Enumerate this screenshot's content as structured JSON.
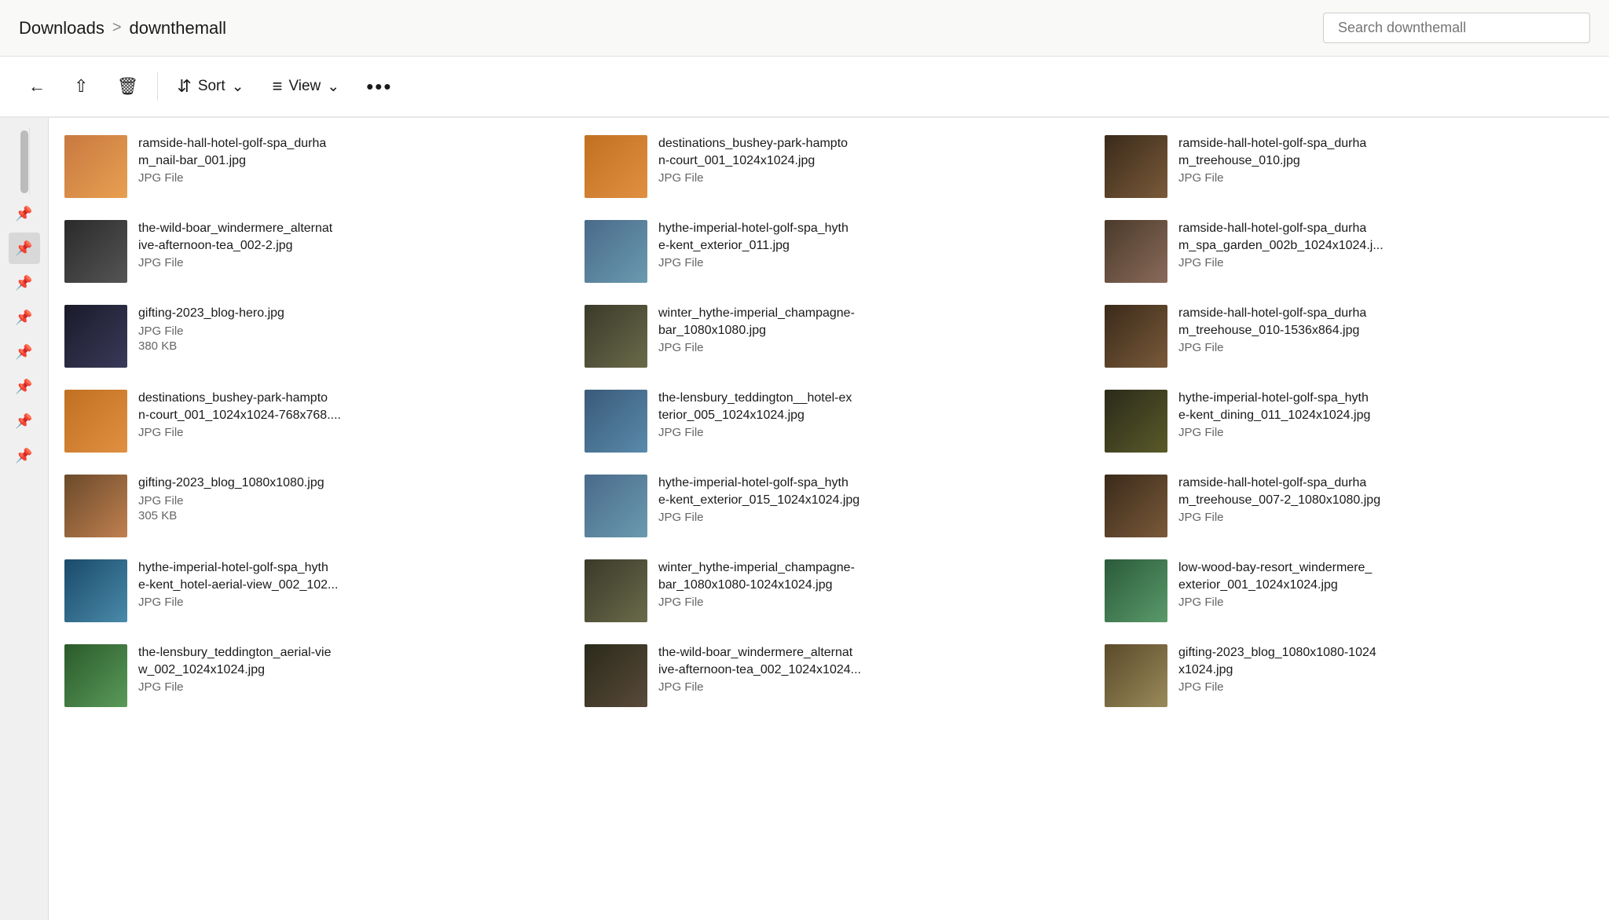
{
  "header": {
    "breadcrumb_home": "Downloads",
    "breadcrumb_sep": ">",
    "breadcrumb_current": "downthemall",
    "search_placeholder": "Search downthemall"
  },
  "toolbar": {
    "share_icon": "↗",
    "delete_icon": "🗑",
    "sort_icon": "↕",
    "sort_label": "Sort",
    "view_icon": "≡",
    "view_label": "View",
    "more_label": "•••"
  },
  "sidebar": {
    "pins": [
      "📌",
      "📌",
      "📌",
      "📌",
      "📌",
      "📌",
      "📌",
      "📌"
    ]
  },
  "files": [
    {
      "name": "ramside-hall-hotel-golf-spa_durha\nm_nail-bar_001.jpg",
      "type": "JPG File",
      "size": "",
      "thumb_class": "thumb-warm-orange"
    },
    {
      "name": "destinations_bushey-park-hampto\nn-court_001_1024x1024.jpg",
      "type": "JPG File",
      "size": "",
      "thumb_class": "thumb-autumn"
    },
    {
      "name": "ramside-hall-hotel-golf-spa_durha\nm_treehouse_010.jpg",
      "type": "JPG File",
      "size": "",
      "thumb_class": "thumb-treehouse"
    },
    {
      "name": "the-wild-boar_windermere_alternat\nive-afternoon-tea_002-2.jpg",
      "type": "JPG File",
      "size": "",
      "thumb_class": "thumb-indoor"
    },
    {
      "name": "hythe-imperial-hotel-golf-spa_hyth\ne-kent_exterior_011.jpg",
      "type": "JPG File",
      "size": "",
      "thumb_class": "thumb-hotel"
    },
    {
      "name": "ramside-hall-hotel-golf-spa_durha\nm_spa_garden_002b_1024x1024.j...",
      "type": "JPG File",
      "size": "",
      "thumb_class": "thumb-spa"
    },
    {
      "name": "gifting-2023_blog-hero.jpg",
      "type": "JPG File",
      "size": "380 KB",
      "thumb_class": "thumb-lights"
    },
    {
      "name": "winter_hythe-imperial_champagne-\nbar_1080x1080.jpg",
      "type": "JPG File",
      "size": "",
      "thumb_class": "thumb-champagne"
    },
    {
      "name": "ramside-hall-hotel-golf-spa_durha\nm_treehouse_010-1536x864.jpg",
      "type": "JPG File",
      "size": "",
      "thumb_class": "thumb-treehouse"
    },
    {
      "name": "destinations_bushey-park-hampto\nn-court_001_1024x1024-768x768....",
      "type": "JPG File",
      "size": "",
      "thumb_class": "thumb-autumn"
    },
    {
      "name": "the-lensbury_teddington__hotel-ex\nterior_005_1024x1024.jpg",
      "type": "JPG File",
      "size": "",
      "thumb_class": "thumb-exterior"
    },
    {
      "name": "hythe-imperial-hotel-golf-spa_hyth\ne-kent_dining_011_1024x1024.jpg",
      "type": "JPG File",
      "size": "",
      "thumb_class": "thumb-food"
    },
    {
      "name": "gifting-2023_blog_1080x1080.jpg",
      "type": "JPG File",
      "size": "305 KB",
      "thumb_class": "thumb-giftbox"
    },
    {
      "name": "hythe-imperial-hotel-golf-spa_hyth\ne-kent_exterior_015_1024x1024.jpg",
      "type": "JPG File",
      "size": "",
      "thumb_class": "thumb-hotel"
    },
    {
      "name": "ramside-hall-hotel-golf-spa_durha\nm_treehouse_007-2_1080x1080.jpg",
      "type": "JPG File",
      "size": "",
      "thumb_class": "thumb-treehouse"
    },
    {
      "name": "hythe-imperial-hotel-golf-spa_hyth\ne-kent_hotel-aerial-view_002_102...",
      "type": "JPG File",
      "size": "",
      "thumb_class": "thumb-aerial"
    },
    {
      "name": "winter_hythe-imperial_champagne-\nbar_1080x1080-1024x1024.jpg",
      "type": "JPG File",
      "size": "",
      "thumb_class": "thumb-champagne"
    },
    {
      "name": "low-wood-bay-resort_windermere_\nexterior_001_1024x1024.jpg",
      "type": "JPG File",
      "size": "",
      "thumb_class": "thumb-lowwood"
    },
    {
      "name": "the-lensbury_teddington_aerial-vie\nw_002_1024x1024.jpg",
      "type": "JPG File",
      "size": "",
      "thumb_class": "thumb-aerial2"
    },
    {
      "name": "the-wild-boar_windermere_alternat\nive-afternoon-tea_002_1024x1024...",
      "type": "JPG File",
      "size": "",
      "thumb_class": "thumb-tea"
    },
    {
      "name": "gifting-2023_blog_1080x1080-1024\nx1024.jpg",
      "type": "JPG File",
      "size": "",
      "thumb_class": "thumb-giftbig"
    }
  ]
}
